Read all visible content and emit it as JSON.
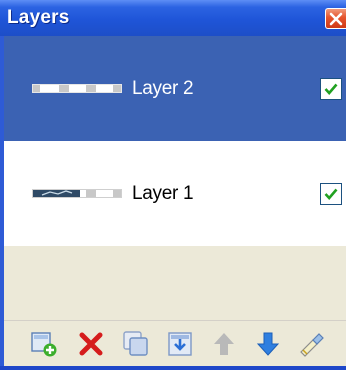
{
  "window": {
    "title": "Layers",
    "close_icon": "close-icon"
  },
  "layers": [
    {
      "label": "Layer 2",
      "visible": true,
      "selected": true,
      "thumbnail_icon": "layer-thumbnail-icon"
    },
    {
      "label": "Layer 1",
      "visible": true,
      "selected": false,
      "thumbnail_icon": "layer-thumbnail-icon"
    }
  ],
  "toolbar": {
    "buttons": [
      {
        "name": "add-layer",
        "icon": "add-layer-icon"
      },
      {
        "name": "delete-layer",
        "icon": "delete-icon"
      },
      {
        "name": "duplicate-layer",
        "icon": "duplicate-icon"
      },
      {
        "name": "merge-layer-down",
        "icon": "merge-down-icon"
      },
      {
        "name": "move-layer-up",
        "icon": "arrow-up-icon"
      },
      {
        "name": "move-layer-down",
        "icon": "arrow-down-icon"
      },
      {
        "name": "layer-properties",
        "icon": "properties-icon"
      }
    ]
  },
  "colors": {
    "title_bar": "#1f55d8",
    "selected_row": "#3b62b3",
    "panel_background": "#ece9d8",
    "close_button": "#e5542d"
  }
}
